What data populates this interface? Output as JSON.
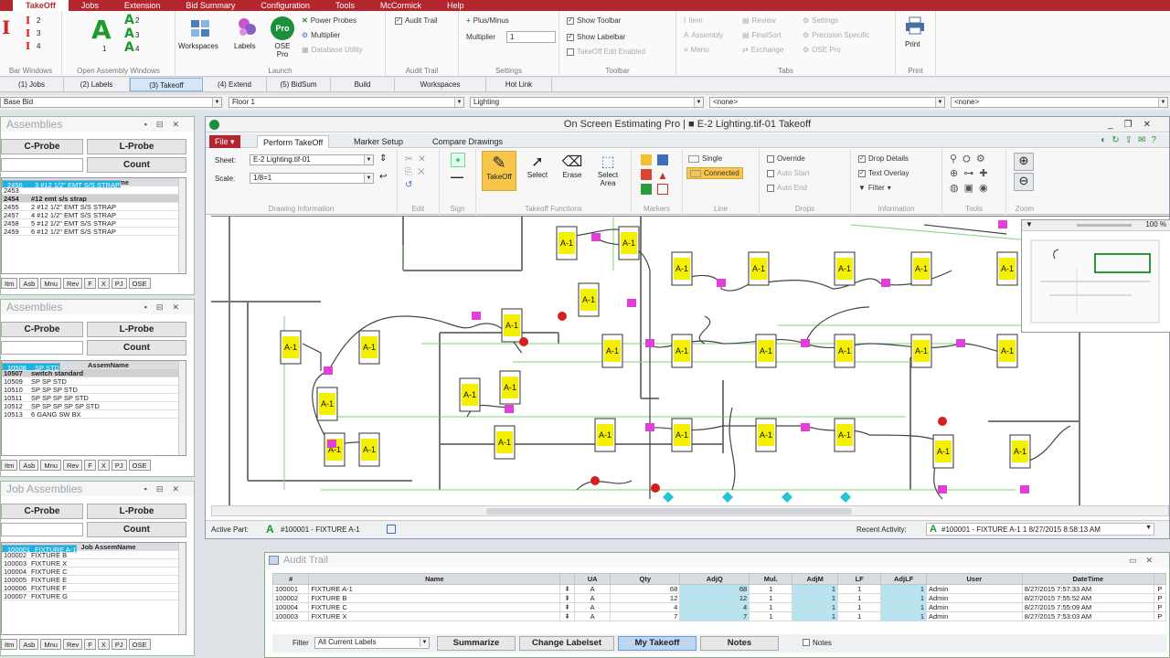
{
  "menubar": {
    "items": [
      "TakeOff",
      "Jobs",
      "Extension",
      "Bid Summary",
      "Configuration",
      "Tools",
      "McCormick",
      "Help"
    ],
    "active_index": 0
  },
  "ribbon": {
    "groups": {
      "bar_windows": "Bar Windows",
      "open_assembly_windows": "Open Assembly Windows",
      "launch": "Launch",
      "audit_trail": "Audit Trail",
      "settings": "Settings",
      "toolbar": "Toolbar",
      "tabs": "Tabs",
      "print": "Print"
    },
    "bar_counts": [
      "2",
      "3",
      "4"
    ],
    "assembly_counts": [
      "1",
      "2",
      "3",
      "4"
    ],
    "launch_buttons": {
      "workspaces": "Workspaces",
      "labels": "Labels",
      "ose_pro": "OSE Pro",
      "ose_badge": "Pro",
      "power_probes": "Power Probes",
      "multiplier": "Multiplier",
      "database_utility": "Database Utility"
    },
    "audit_trail_label": "Audit Trail",
    "settings": {
      "plus_minus": "Plus/Minus",
      "multiplier_label": "Multiplier",
      "multiplier_value": "1"
    },
    "toolbar": {
      "show_toolbar": "Show Toolbar",
      "show_labelbar": "Show Labelbar",
      "takeoff_edit_enabled": "TakeOff Edit Enabled"
    },
    "tabs": {
      "item": "Item",
      "assembly": "Assembly",
      "menu": "Menu",
      "review": "Review",
      "finalsort": "FinalSort",
      "exchange": "Exchange",
      "settings": "Settings",
      "precision_specific": "Precision Specific",
      "ose_pro": "OSE Pro"
    },
    "print_label": "Print"
  },
  "tabstrip": {
    "tabs": [
      "(1) Jobs",
      "(2) Labels",
      "(3) Takeoff",
      "(4) Extend",
      "(5) BidSum",
      "Build",
      "Workspaces",
      "Hot Link"
    ],
    "active_index": 2
  },
  "filters": {
    "bid": "Base Bid",
    "floor": "Floor 1",
    "system": "Lighting",
    "none1": "<none>",
    "none2": "<none>"
  },
  "panels": [
    {
      "title": "Assemblies",
      "probe_c": "C-Probe",
      "probe_l": "L-Probe",
      "count": "Count",
      "headers": {
        "no": "No",
        "name": "AssemName"
      },
      "rows": [
        {
          "no": "2453",
          "name": ""
        },
        {
          "no": "2454",
          "name": "#12 emt s/s strap"
        },
        {
          "no": "2455",
          "name": "2 #12 1/2\" EMT S/S STRAP"
        },
        {
          "no": "2456",
          "name": "3 #12 1/2\" EMT S/S STRAP"
        },
        {
          "no": "2457",
          "name": "4 #12 1/2\" EMT S/S STRAP"
        },
        {
          "no": "2458",
          "name": "5 #12 1/2\" EMT S/S STRAP"
        },
        {
          "no": "2459",
          "name": "6 #12 1/2\" EMT S/S STRAP"
        }
      ],
      "selected_row": 3,
      "dark_row": 1,
      "footer": [
        "Itm",
        "Asb",
        "Mnu",
        "Rev",
        "F",
        "X",
        "PJ",
        "OSE"
      ]
    },
    {
      "title": "Assemblies",
      "probe_c": "C-Probe",
      "probe_l": "L-Probe",
      "count": "Count",
      "headers": {
        "no": "No",
        "name": "AssemName"
      },
      "rows": [
        {
          "no": "10507",
          "name": "switch standard"
        },
        {
          "no": "10508",
          "name": "SP          STD"
        },
        {
          "no": "10509",
          "name": "SP SP         STD"
        },
        {
          "no": "10510",
          "name": "SP SP SP       STD"
        },
        {
          "no": "10511",
          "name": "SP SP SP SP      STD"
        },
        {
          "no": "10512",
          "name": "SP SP SP SP SP  STD"
        },
        {
          "no": "10513",
          "name": "6 GANG SW BX"
        }
      ],
      "selected_row": 1,
      "dark_row": 0,
      "footer": [
        "Itm",
        "Asb",
        "Mnu",
        "Rev",
        "F",
        "X",
        "PJ",
        "OSE"
      ]
    },
    {
      "title": "Job Assemblies",
      "probe_c": "C-Probe",
      "probe_l": "L-Probe",
      "count": "Count",
      "headers": {
        "no": "No",
        "name": "Job AssemName"
      },
      "rows": [
        {
          "no": "100001",
          "name": "FIXTURE A-1"
        },
        {
          "no": "100002",
          "name": "FIXTURE B"
        },
        {
          "no": "100003",
          "name": "FIXTURE X"
        },
        {
          "no": "100004",
          "name": "FIXTURE C"
        },
        {
          "no": "100005",
          "name": "FIXTURE E"
        },
        {
          "no": "100006",
          "name": "FIXTURE F"
        },
        {
          "no": "100007",
          "name": "FIXTURE G"
        }
      ],
      "selected_row": 0,
      "dark_row": -1,
      "footer": [
        "Itm",
        "Asb",
        "Mnu",
        "Rev",
        "F",
        "X",
        "PJ",
        "OSE"
      ]
    }
  ],
  "main_window": {
    "title": "On Screen Estimating Pro | ■ E-2 Lighting.tif-01 Takeoff",
    "file_button": "File",
    "tabs": [
      "Perform TakeOff",
      "Marker Setup",
      "Compare Drawings"
    ],
    "active_tab": 0,
    "sheet_label": "Sheet:",
    "sheet_value": "E-2 Lighting.tif-01",
    "scale_label": "Scale:",
    "scale_value": "1/8=1",
    "groups": {
      "drawing_information": "Drawing Information",
      "edit": "Edit",
      "sign": "Sign",
      "takeoff_functions": "Takeoff Functions",
      "markers": "Markers",
      "line": "Line",
      "drops": "Drops",
      "information": "Information",
      "tools": "Tools",
      "zoom": "Zoom"
    },
    "takeoff_tools": [
      "TakeOff",
      "Select",
      "Erase",
      "Select Area"
    ],
    "line_options": [
      "Single",
      "Connected"
    ],
    "drops_options": [
      "Override",
      "Auto Start",
      "Auto End"
    ],
    "info_options": [
      "Drop Details",
      "Text Overlay",
      "Filter"
    ],
    "minimap_zoom": "100 %",
    "fixture_label": "A-1",
    "active_part_label": "Active Part:",
    "active_part_value": "#100001 - FIXTURE  A-1",
    "recent_activity_label": "Recent Activity:",
    "recent_activity_value": "#100001 - FIXTURE  A-1 1  8/27/2015 8:58:13 AM"
  },
  "audit": {
    "title": "Audit Trail",
    "headers": [
      "#",
      "Name",
      "",
      "UA",
      "Qty",
      "AdjQ",
      "Mul.",
      "AdjM",
      "LF",
      "AdjLF",
      "User",
      "DateTime",
      ""
    ],
    "rows": [
      {
        "no": "100001",
        "name": "FIXTURE  A-1",
        "ua": "A",
        "qty": "68",
        "adjq": "68",
        "mul": "1",
        "adjm": "1",
        "lf": "1",
        "adjlf": "1",
        "user": "Admin",
        "dt": "8/27/2015 7:57:33 AM",
        "p": "P"
      },
      {
        "no": "100002",
        "name": "FIXTURE  B",
        "ua": "A",
        "qty": "12",
        "adjq": "12",
        "mul": "1",
        "adjm": "1",
        "lf": "1",
        "adjlf": "1",
        "user": "Admin",
        "dt": "8/27/2015 7:55:52 AM",
        "p": "P"
      },
      {
        "no": "100004",
        "name": "FIXTURE  C",
        "ua": "A",
        "qty": "4",
        "adjq": "4",
        "mul": "1",
        "adjm": "1",
        "lf": "1",
        "adjlf": "1",
        "user": "Admin",
        "dt": "8/27/2015 7:55:09 AM",
        "p": "P"
      },
      {
        "no": "100003",
        "name": "FIXTURE  X",
        "ua": "A",
        "qty": "7",
        "adjq": "7",
        "mul": "1",
        "adjm": "1",
        "lf": "1",
        "adjlf": "1",
        "user": "Admin",
        "dt": "8/27/2015 7:53:03 AM",
        "p": "P"
      }
    ],
    "filter_label": "Filter",
    "filter_value": "All Current Labels",
    "buttons": [
      "Summarize",
      "Change Labelset",
      "My Takeoff",
      "Notes"
    ],
    "active_button": 2,
    "notes_check": "Notes"
  },
  "colors": {
    "accent_red": "#b3262e",
    "select_blue": "#19b2e6",
    "fixture_yellow": "#f4f000",
    "junction_magenta": "#e040d8",
    "wire_green": "#7fd07f"
  }
}
